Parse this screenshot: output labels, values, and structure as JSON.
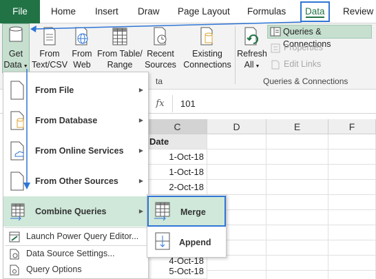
{
  "tabs": [
    {
      "label": "File"
    },
    {
      "label": "Home"
    },
    {
      "label": "Insert"
    },
    {
      "label": "Draw"
    },
    {
      "label": "Page Layout"
    },
    {
      "label": "Formulas"
    },
    {
      "label": "Data"
    },
    {
      "label": "Review"
    }
  ],
  "ribbon": {
    "get_data": {
      "line1": "Get",
      "line2": "Data"
    },
    "from_text": {
      "line1": "From",
      "line2": "Text/CSV"
    },
    "from_web": {
      "line1": "From",
      "line2": "Web"
    },
    "from_table": {
      "line1": "From Table/",
      "line2": "Range"
    },
    "recent_sources": {
      "line1": "Recent",
      "line2": "Sources"
    },
    "existing_connections": {
      "line1": "Existing",
      "line2": "Connections"
    },
    "group_label_partial": "ta",
    "refresh": {
      "line1": "Refresh",
      "line2": "All"
    },
    "queries_connections": "Queries & Connections",
    "properties": "Properties",
    "edit_links": "Edit Links",
    "group_label_qc": "Queries & Connections",
    "accent": "#217346",
    "highlight": "#2e75d5"
  },
  "formula_bar": {
    "fx": "fx",
    "value": "101"
  },
  "columns": [
    "C",
    "D",
    "E",
    "F"
  ],
  "column_c": {
    "header": "Date",
    "values": [
      "1-Oct-18",
      "1-Oct-18",
      "2-Oct-18",
      "",
      "",
      "",
      "",
      "4-Oct-18",
      "5-Oct-18"
    ]
  },
  "menu": {
    "from_file": "From File",
    "from_database": "From Database",
    "from_online": "From Online Services",
    "from_other": "From Other Sources",
    "combine": "Combine Queries",
    "launch_pq": "Launch Power Query Editor...",
    "ds_settings": "Data Source Settings...",
    "query_options": "Query Options"
  },
  "submenu": {
    "merge": "Merge",
    "append": "Append"
  }
}
